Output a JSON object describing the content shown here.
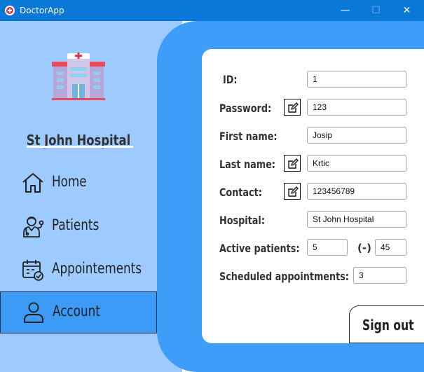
{
  "window": {
    "title": "DoctorApp",
    "minimize": "—",
    "maximize": "☐",
    "close": "✕"
  },
  "sidebar": {
    "hospital_name": "St John Hospital",
    "items": [
      {
        "label": "Home",
        "icon": "home-icon"
      },
      {
        "label": "Patients",
        "icon": "doctor-icon"
      },
      {
        "label": "Appointements",
        "icon": "calendar-check-icon"
      },
      {
        "label": "Account",
        "icon": "user-icon",
        "selected": true
      }
    ]
  },
  "form": {
    "id_label": "ID:",
    "id_value": "1",
    "password_label": "Password:",
    "password_value": "123",
    "first_name_label": "First name:",
    "first_name_value": "Josip",
    "last_name_label": "Last name:",
    "last_name_value": "Krtic",
    "contact_label": "Contact:",
    "contact_value": "123456789",
    "hospital_label": "Hospital:",
    "hospital_value": "St John Hospital",
    "active_patients_label": "Active patients:",
    "active_patients_value": "5",
    "active_patients_sep": "(-)",
    "active_patients_max": "45",
    "scheduled_label": "Scheduled appointments:",
    "scheduled_value": "3"
  },
  "signout_label": "Sign out",
  "colors": {
    "titlebar": "#0a78d7",
    "sidebar": "#9ecbff",
    "panel": "#3d9df8",
    "selected": "#3b9bf7"
  }
}
